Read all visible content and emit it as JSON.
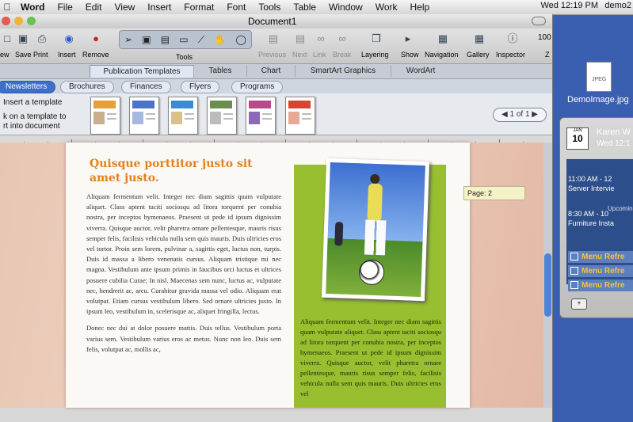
{
  "menubar": {
    "items": [
      "Word",
      "File",
      "Edit",
      "View",
      "Insert",
      "Format",
      "Font",
      "Tools",
      "Table",
      "Window",
      "Work",
      "Help"
    ],
    "clock": "Wed 12:19 PM",
    "user": "demo2"
  },
  "window": {
    "title": "Document1"
  },
  "toolbar": {
    "new": "ew",
    "save": "Save",
    "print": "Print",
    "insert": "Insert",
    "remove": "Remove",
    "tools": "Tools",
    "previous": "Previous",
    "next": "Next",
    "link": "Link",
    "break": "Break",
    "layering": "Layering",
    "show": "Show",
    "navigation": "Navigation",
    "gallery": "Gallery",
    "inspector": "Inspector",
    "zoom": "100",
    "zoom_label": "Z"
  },
  "ribbon": {
    "tabs": [
      "Publication Templates",
      "Tables",
      "Chart",
      "SmartArt Graphics",
      "WordArt"
    ]
  },
  "gallery": {
    "categories": [
      "Newsletters",
      "Brochures",
      "Finances",
      "Flyers",
      "Programs"
    ],
    "help_title": "Insert a template",
    "help_line1": "k on a template to",
    "help_line2": "rt into document",
    "pager": "1 of 1"
  },
  "document": {
    "heading": "Quisque porttitor justo sit amet justo.",
    "col1_p1": "Aliquam fermentum velit. Integer nec diam sagittis quam vulputate aliquet. Class aptent taciti sociosqu ad litora torquent per conubia nostra, per inceptos hymenaeos. Praesent ut pede id ipsum dignissim viverra. Quisque auctor, velit pharetra ornare pellentesque, mauris risus semper felis, facilisis vehicula nulla sem quis mauris. Duis ultricies eros vel tortor. Proin sem lorem, pulvinar a, sagittis eget, luctus non, turpis. Duis id massa a libero venenatis cursus. Aliquam tristique mi nec magna. Vestibulum ante ipsum primis in faucibus orci luctus et ultrices posuere cubilia Curae; In nisl. Maecenas sem nunc, luctus ac, vulputate nec, hendrerit ac, arcu. Curabitur gravida massa vel odio. Aliquam erat volutpat. Etiam cursus vestibulum libero. Sed ornare ultricies justo. In ipsum leo, vestibulum in, scelerisque ac, aliquet fringilla, lectus.",
    "col1_p2": "Donec nec dui at dolor posuere mattis. Duis tellus. Vestibulum porta varius sem. Vestibulum varius eros ac metus. Nunc non leo. Duis sem felis, volutpat ac, mollis ac,",
    "col2": "Aliquam fermentum velit. Integer nec diam sagittis quam vulputate aliquet. Class aptent taciti sociosqu ad litora torquent per conubia nostra, per inceptos hymenaeos. Praesent ut pede id ipsum dignissim viverra. Quisque auctor, velit pharetra ornare pellentesque, mauris risus semper felis, facilisis vehicula nulla sem quis mauris. Duis ultricies eros vel",
    "page_tip": "Page: 2"
  },
  "desktop": {
    "file_label": "DemoImage.jpg",
    "file_type": "JPEG"
  },
  "widget": {
    "cal_month": "JAN",
    "cal_day": "10",
    "name": "Karen W",
    "date": "Wed 12:1",
    "time1": "11:00 AM - 12",
    "event1": "Server Intervie",
    "upcoming": "Upcoming",
    "time2": "8:30 AM - 10",
    "event2": "Furniture Insta",
    "task": "Menu Refre"
  },
  "colors": {
    "accent": "#e4811a",
    "sidebar_green": "#97bf2f",
    "selection_blue": "#3f6fc8"
  }
}
